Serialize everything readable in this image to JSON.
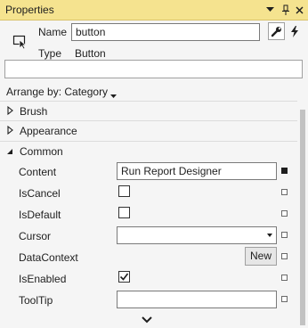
{
  "titlebar": {
    "title": "Properties",
    "dropdown_icon": "chevron-down-icon",
    "pin_icon": "pin-icon",
    "close_icon": "close-icon",
    "background": "#f5e38f"
  },
  "header": {
    "name_label": "Name",
    "name_value": "button",
    "type_label": "Type",
    "type_value": "Button",
    "properties_tool_icon": "wrench-icon",
    "events_tool_icon": "lightning-icon",
    "element_icon": "pointer-icon",
    "search_placeholder": ""
  },
  "arrange": {
    "label": "Arrange by: Category",
    "dropdown_icon": "triangle-down-icon"
  },
  "categories": [
    {
      "label": "Brush",
      "expanded": false
    },
    {
      "label": "Appearance",
      "expanded": false
    },
    {
      "label": "Common",
      "expanded": true
    }
  ],
  "properties": [
    {
      "name": "Content",
      "editor": "text",
      "value": "Run Report Designer",
      "set": true
    },
    {
      "name": "IsCancel",
      "editor": "checkbox",
      "checked": false,
      "set": false
    },
    {
      "name": "IsDefault",
      "editor": "checkbox",
      "checked": false,
      "set": false
    },
    {
      "name": "Cursor",
      "editor": "combo",
      "value": "",
      "set": false
    },
    {
      "name": "DataContext",
      "editor": "button",
      "button_label": "New",
      "set": false
    },
    {
      "name": "IsEnabled",
      "editor": "checkbox",
      "checked": true,
      "set": false
    },
    {
      "name": "ToolTip",
      "editor": "text",
      "value": "",
      "set": false
    }
  ],
  "footer": {
    "more_icon": "chevron-down-icon"
  }
}
